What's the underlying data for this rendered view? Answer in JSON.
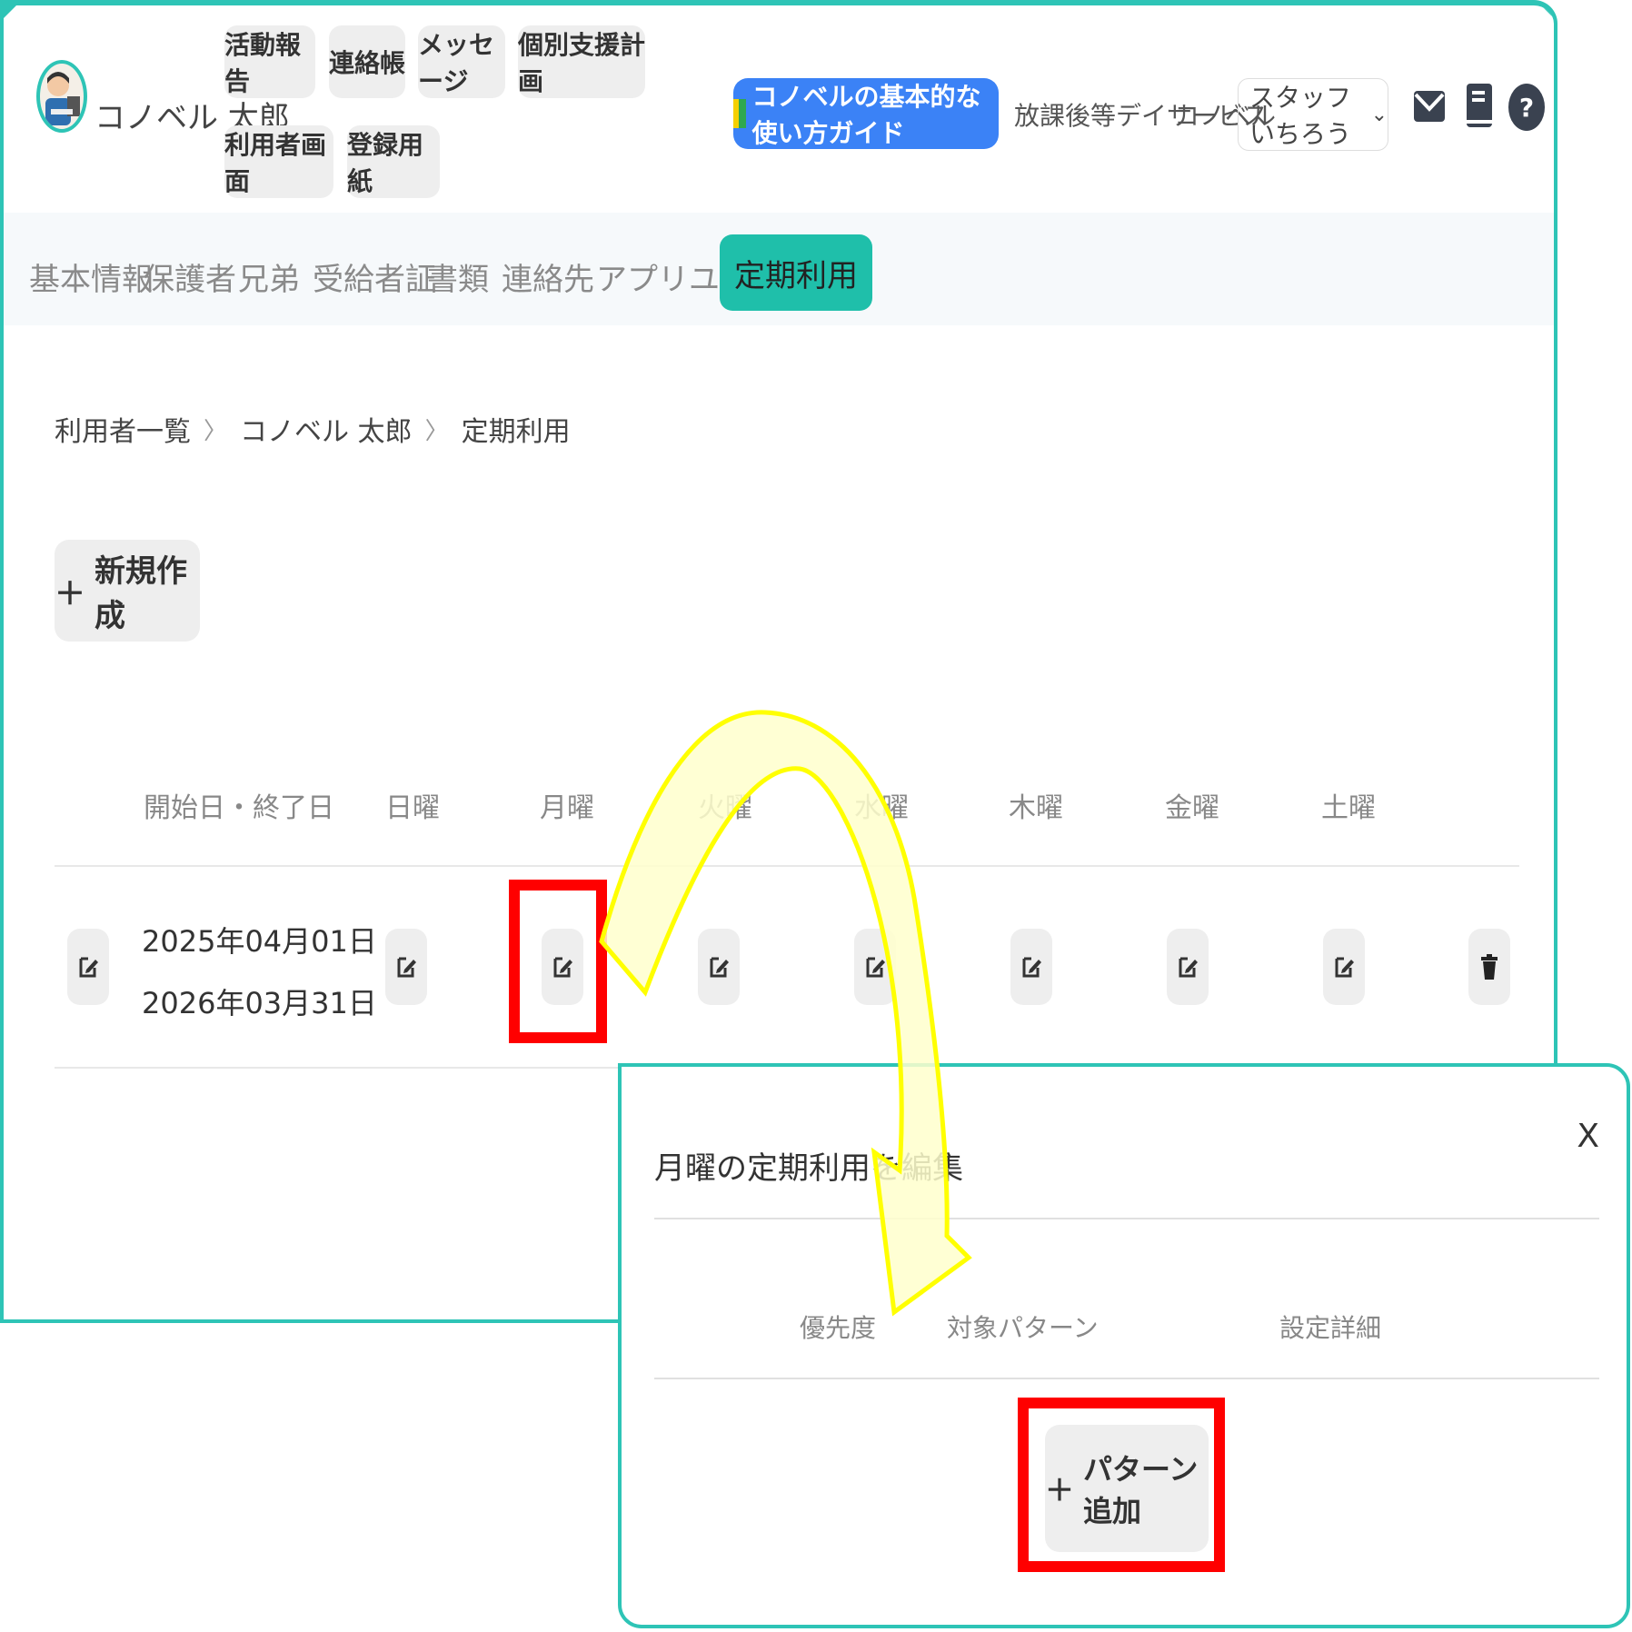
{
  "header": {
    "user_name": "コノベル 太郎",
    "nav": [
      "活動報告",
      "連絡帳",
      "メッセージ",
      "個別支援計画",
      "利用者画面",
      "登録用紙"
    ],
    "guide_label": "コノベルの基本的な使い方ガイド",
    "facility": "放課後等デイサービス",
    "company": "コノベル",
    "staff": "スタッフ いちろう",
    "icons": [
      "mail-icon",
      "book-icon",
      "help-icon"
    ]
  },
  "tabs": [
    "基本情報",
    "保護者",
    "兄弟",
    "受給者証",
    "書類",
    "連絡先",
    "アプリユーザー",
    "定期利用"
  ],
  "active_tab": "定期利用",
  "breadcrumb": [
    "利用者一覧",
    "コノベル 太郎",
    "定期利用"
  ],
  "new_button": "新規作成",
  "table": {
    "headers": [
      "開始日・終了日",
      "日曜",
      "月曜",
      "火曜",
      "水曜",
      "木曜",
      "金曜",
      "土曜"
    ],
    "row": {
      "start": "2025年04月01日 ～",
      "end": "2026年03月31日"
    }
  },
  "modal": {
    "title": "月曜の定期利用を編集",
    "close": "X",
    "headers": [
      "優先度",
      "対象パターン",
      "設定詳細"
    ],
    "add_button": "パターン追加"
  },
  "colors": {
    "accent": "#2ec4b6",
    "guide": "#3b82f6",
    "highlight": "#ff0000",
    "arrow_fill": "#ffffcc",
    "arrow_stroke": "#ffff00"
  }
}
